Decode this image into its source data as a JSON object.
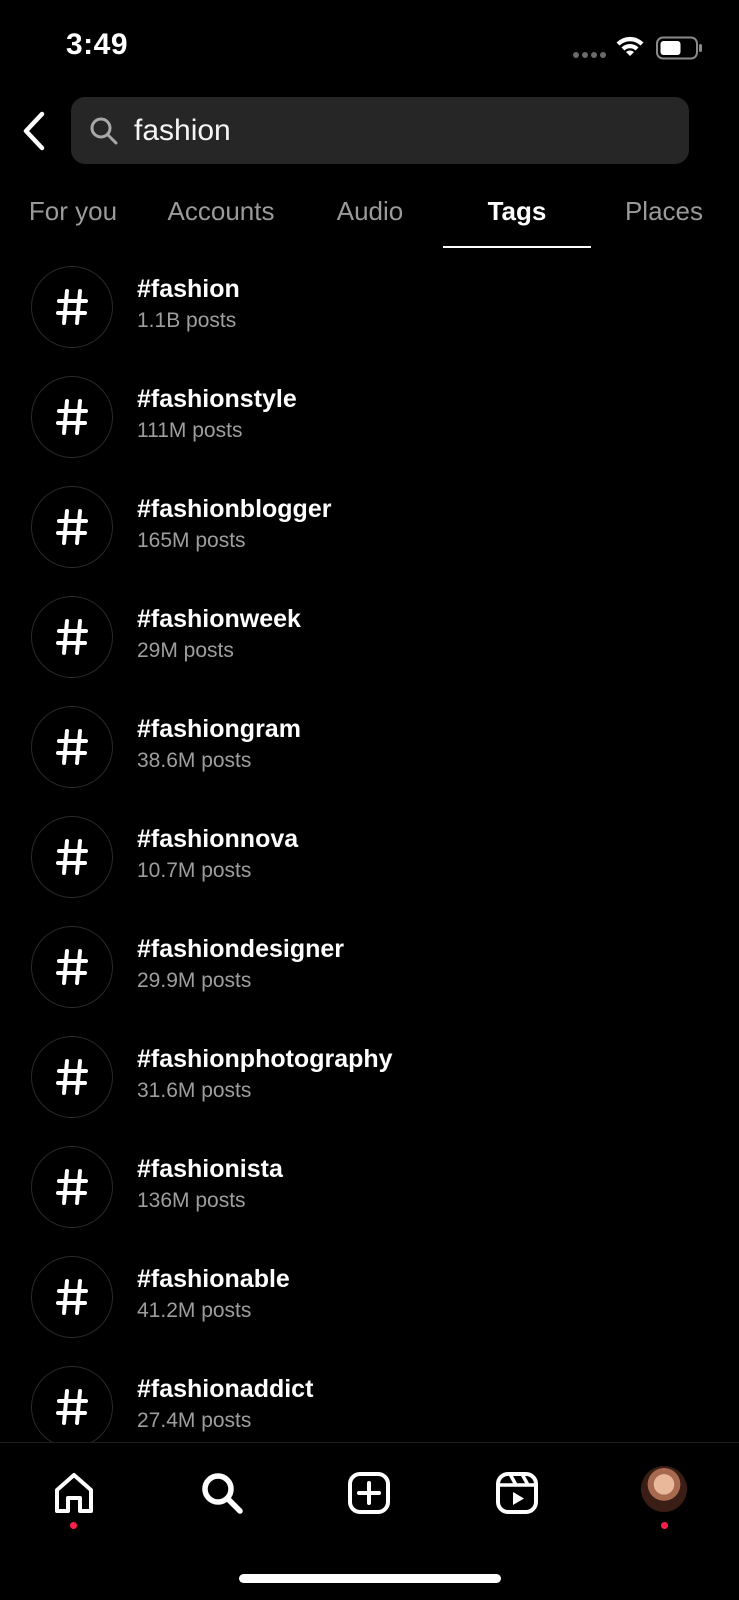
{
  "status_bar": {
    "time": "3:49"
  },
  "search": {
    "query": "fashion"
  },
  "tabs": [
    {
      "label": "For you",
      "active": false
    },
    {
      "label": "Accounts",
      "active": false
    },
    {
      "label": "Audio",
      "active": false
    },
    {
      "label": "Tags",
      "active": true
    },
    {
      "label": "Places",
      "active": false
    }
  ],
  "tags": [
    {
      "name": "#fashion",
      "count": "1.1B posts"
    },
    {
      "name": "#fashionstyle",
      "count": "111M posts"
    },
    {
      "name": "#fashionblogger",
      "count": "165M posts"
    },
    {
      "name": "#fashionweek",
      "count": "29M posts"
    },
    {
      "name": "#fashiongram",
      "count": "38.6M posts"
    },
    {
      "name": "#fashionnova",
      "count": "10.7M posts"
    },
    {
      "name": "#fashiondesigner",
      "count": "29.9M posts"
    },
    {
      "name": "#fashionphotography",
      "count": "31.6M posts"
    },
    {
      "name": "#fashionista",
      "count": "136M posts"
    },
    {
      "name": "#fashionable",
      "count": "41.2M posts"
    },
    {
      "name": "#fashionaddict",
      "count": "27.4M posts"
    }
  ],
  "nav": {
    "items": [
      "home-icon",
      "search-icon",
      "create-icon",
      "reels-icon",
      "profile-avatar"
    ],
    "active": "search-icon",
    "notification_color": "#ff1f4b"
  },
  "colors": {
    "background": "#000000",
    "search_field": "#262626",
    "secondary_text": "#9e9e9e"
  }
}
